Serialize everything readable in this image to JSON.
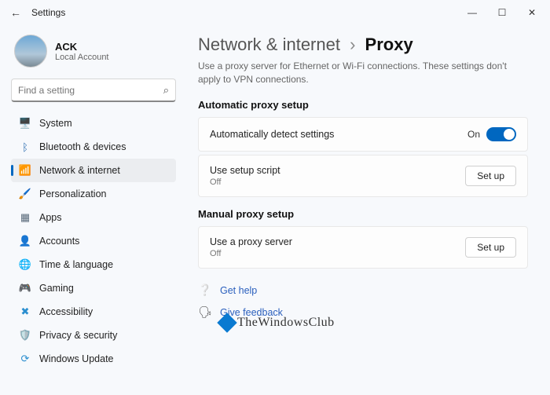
{
  "titlebar": {
    "title": "Settings"
  },
  "user": {
    "name": "ACK",
    "sub": "Local Account"
  },
  "search": {
    "placeholder": "Find a setting"
  },
  "sidebar": {
    "items": [
      {
        "label": "System",
        "icon": "🖥️",
        "color": "#2b6cb0"
      },
      {
        "label": "Bluetooth & devices",
        "icon": "ᛒ",
        "color": "#2b6cb0"
      },
      {
        "label": "Network & internet",
        "icon": "📶",
        "color": "#2b6cb0"
      },
      {
        "label": "Personalization",
        "icon": "🖌️",
        "color": "#b07433"
      },
      {
        "label": "Apps",
        "icon": "▦",
        "color": "#5a6b7b"
      },
      {
        "label": "Accounts",
        "icon": "👤",
        "color": "#5a6b7b"
      },
      {
        "label": "Time & language",
        "icon": "🌐",
        "color": "#2f9cbf"
      },
      {
        "label": "Gaming",
        "icon": "🎮",
        "color": "#5a6b7b"
      },
      {
        "label": "Accessibility",
        "icon": "✖",
        "color": "#2b8ecf"
      },
      {
        "label": "Privacy & security",
        "icon": "🛡️",
        "color": "#808a93"
      },
      {
        "label": "Windows Update",
        "icon": "⟳",
        "color": "#2b8ecf"
      }
    ],
    "activeIndex": 2
  },
  "main": {
    "breadcrumb_parent": "Network & internet",
    "breadcrumb_current": "Proxy",
    "description": "Use a proxy server for Ethernet or Wi-Fi connections. These settings don't apply to VPN connections.",
    "section_auto": "Automatic proxy setup",
    "auto_detect": {
      "title": "Automatically detect settings",
      "state": "On"
    },
    "setup_script": {
      "title": "Use setup script",
      "sub": "Off",
      "button": "Set up"
    },
    "section_manual": "Manual proxy setup",
    "use_proxy": {
      "title": "Use a proxy server",
      "sub": "Off",
      "button": "Set up"
    },
    "links": {
      "help": "Get help",
      "feedback": "Give feedback"
    }
  },
  "watermark": "TheWindowsClub"
}
